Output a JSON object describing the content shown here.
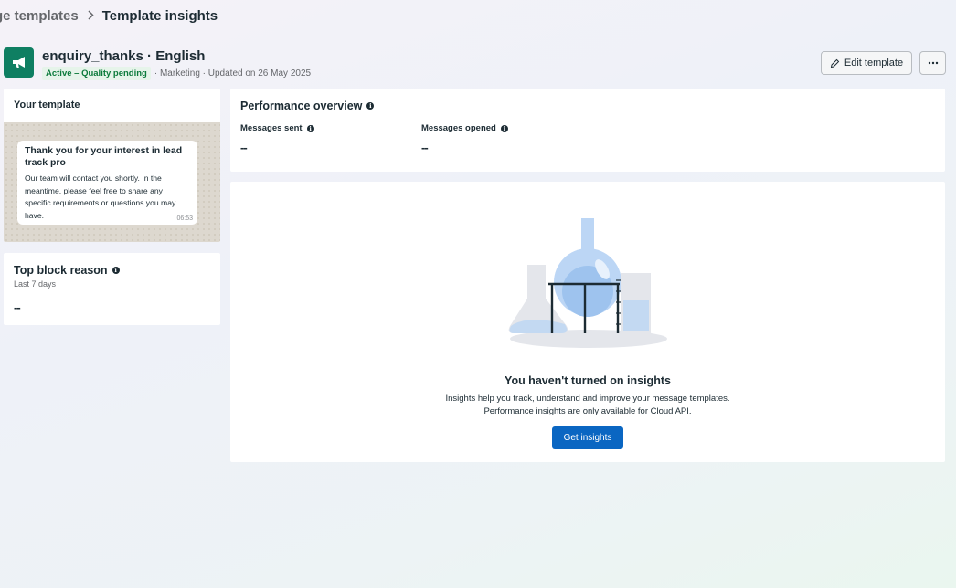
{
  "breadcrumb": {
    "parent": "ge templates",
    "current": "Template insights"
  },
  "header": {
    "icon": "megaphone-icon",
    "title": "enquiry_thanks · English",
    "status_badge": "Active – Quality pending",
    "meta": "· Marketing · Updated on 26 May 2025",
    "edit_label": "Edit template"
  },
  "template_card": {
    "heading": "Your template",
    "message_title": "Thank you for your interest in lead track pro",
    "message_body": "Our team will contact you shortly. In the meantime, please feel free to share any specific requirements or questions you may have.",
    "message_time": "06:53"
  },
  "block_card": {
    "title": "Top block reason",
    "subtitle": "Last 7 days",
    "value": "--"
  },
  "performance": {
    "title": "Performance overview",
    "metrics": [
      {
        "label": "Messages sent",
        "value": "--"
      },
      {
        "label": "Messages opened",
        "value": "--"
      }
    ]
  },
  "empty_state": {
    "title": "You haven't turned on insights",
    "line1": "Insights help you track, understand and improve your message templates.",
    "line2": "Performance insights are only available for Cloud API.",
    "button_label": "Get insights"
  },
  "colors": {
    "brand_green": "#0f7f62",
    "primary_blue": "#0a66c2",
    "badge_green": "#0b7a3b"
  }
}
